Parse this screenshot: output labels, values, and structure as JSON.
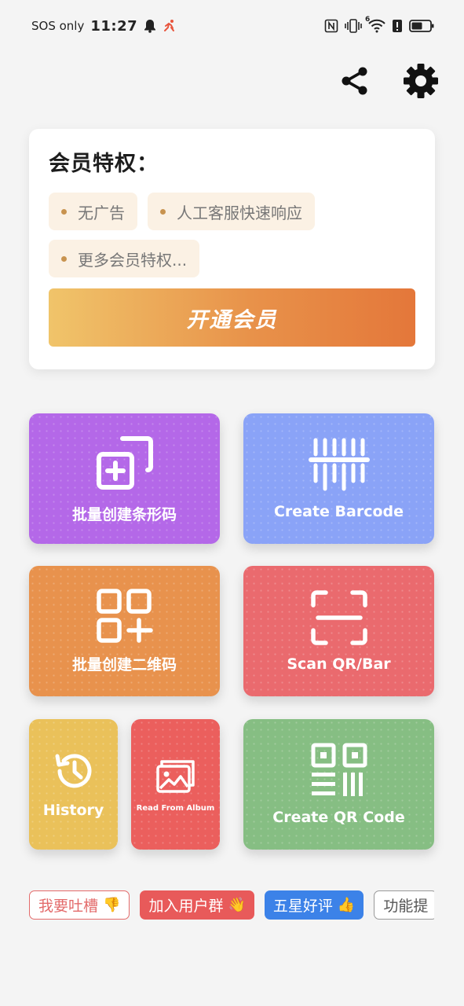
{
  "status_bar": {
    "carrier": "SOS only",
    "time": "11:27",
    "icons": [
      "bell-icon",
      "running-app-icon",
      "nfc-icon",
      "vibrate-icon",
      "wifi-icon",
      "alert-icon",
      "battery-icon"
    ],
    "wifi_badge": "6",
    "alert_badge": "!"
  },
  "top_actions": {
    "share_icon": "share-icon",
    "settings_icon": "gear-icon"
  },
  "member": {
    "title": "会员特权：",
    "perks": [
      "无广告",
      "人工客服快速响应",
      "更多会员特权..."
    ],
    "button": "开通会员"
  },
  "tiles": {
    "batch_barcode": "批量创建条形码",
    "create_barcode": "Create Barcode",
    "batch_qr": "批量创建二维码",
    "scan": "Scan QR/Bar",
    "history": "History",
    "album": "Read From Album",
    "create_qr": "Create QR Code"
  },
  "chips": [
    {
      "label": "我要吐槽",
      "emoji": "👎"
    },
    {
      "label": "加入用户群",
      "emoji": "👋"
    },
    {
      "label": "五星好评",
      "emoji": "👍"
    },
    {
      "label": "功能提",
      "emoji": ""
    }
  ],
  "colors": {
    "purple": "#b468e8",
    "blue": "#8aa3f7",
    "orange": "#e8924d",
    "red": "#ea6a6e",
    "yellow": "#eac15a",
    "album_red": "#eb5f5d",
    "green": "#86be83",
    "gold_gradient_start": "#f0c46a",
    "gold_gradient_end": "#e4773a"
  }
}
